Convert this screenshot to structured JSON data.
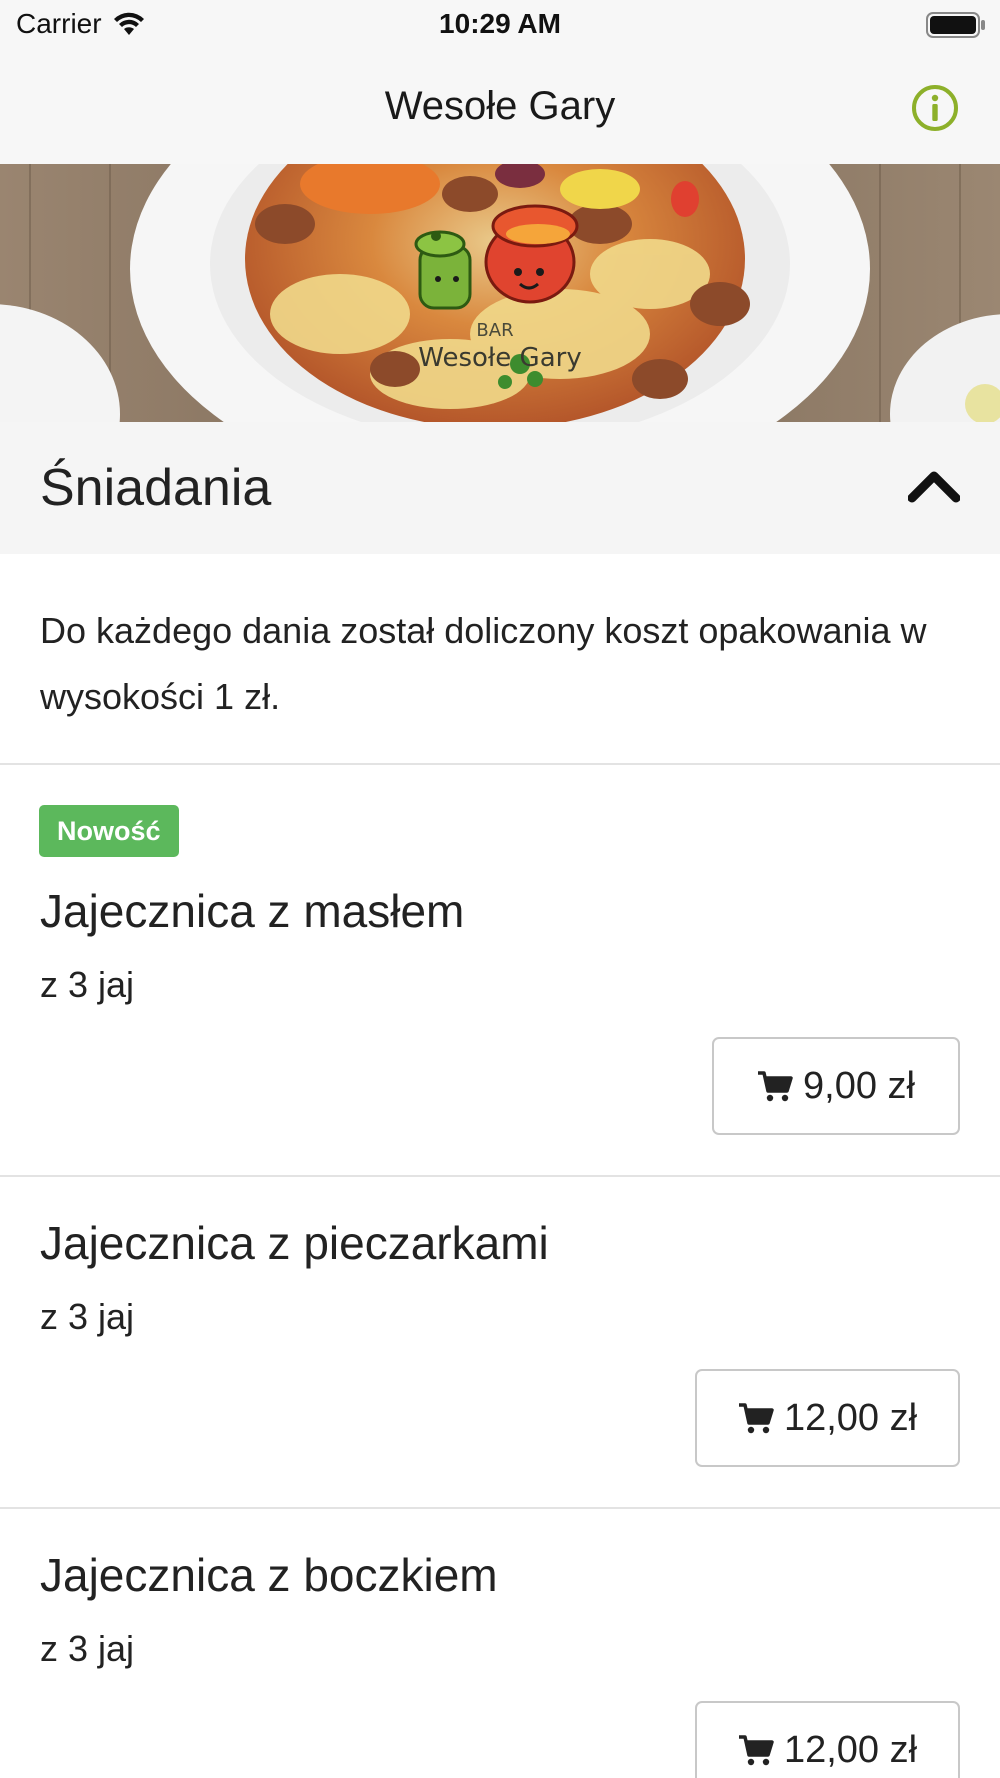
{
  "status": {
    "carrier": "Carrier",
    "time": "10:29 AM"
  },
  "nav": {
    "title": "Wesołe Gary"
  },
  "hero": {
    "logo_line1": "BAR",
    "logo_line2": "Wesołe Gary"
  },
  "section": {
    "title": "Śniadania"
  },
  "notice": "Do każdego dania został doliczony koszt opakowania w wysokości 1 zł.",
  "items": [
    {
      "badge": "Nowość",
      "name": "Jajecznica z masłem",
      "description": "z 3 jaj",
      "price": "9,00 zł"
    },
    {
      "name": "Jajecznica z pieczarkami",
      "description": "z 3 jaj",
      "price": "12,00 zł"
    },
    {
      "name": "Jajecznica z boczkiem",
      "description": "z 3 jaj",
      "price": "12,00 zł"
    }
  ],
  "colors": {
    "accent": "#8db02a",
    "badge": "#5cb85c"
  }
}
